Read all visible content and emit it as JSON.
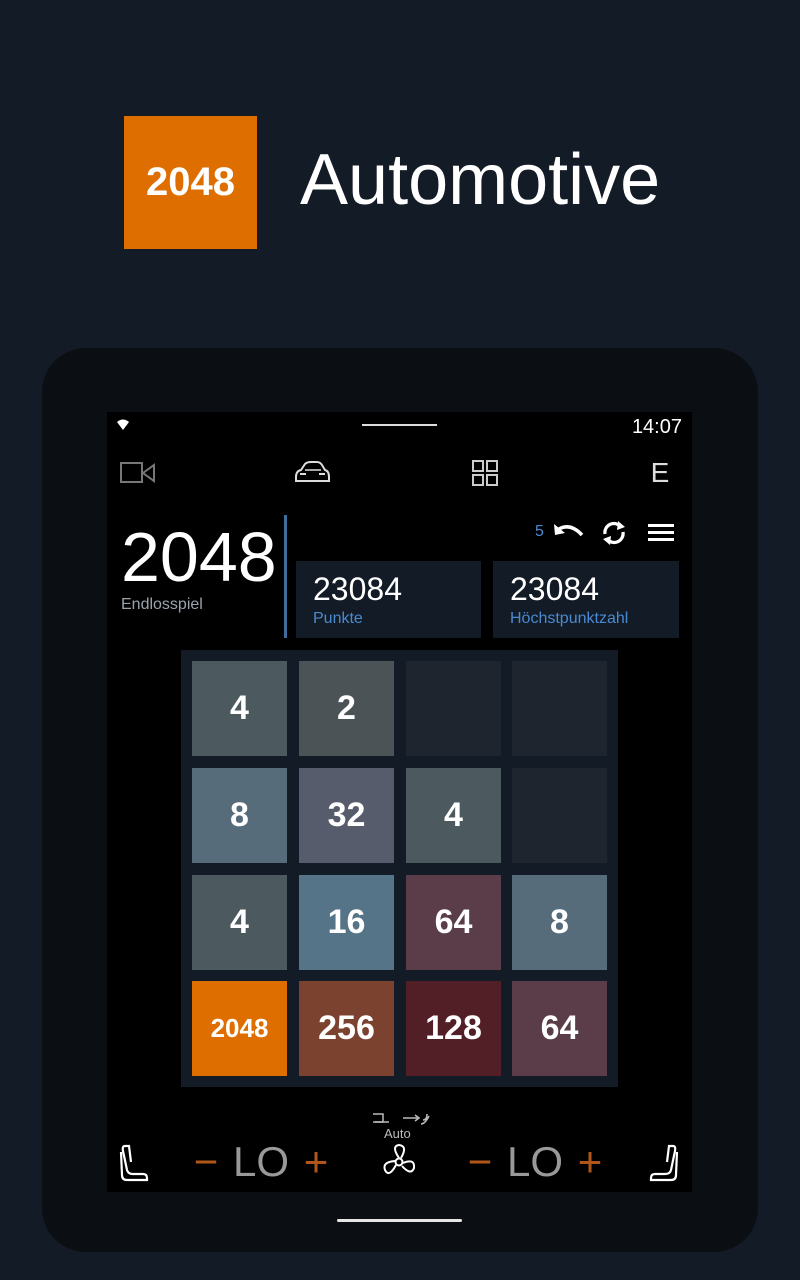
{
  "header": {
    "logo_text": "2048",
    "title": "Automotive"
  },
  "status_bar": {
    "time": "14:07"
  },
  "nav": {
    "cam_icon": "camera-icon",
    "car_icon": "car-icon",
    "apps_icon": "apps-grid-icon",
    "e_label": "E"
  },
  "game": {
    "title": "2048",
    "mode": "Endlosspiel",
    "undo_count": "5",
    "score": {
      "value": "23084",
      "label": "Punkte"
    },
    "best": {
      "value": "23084",
      "label": "Höchstpunktzahl"
    },
    "board": [
      [
        "4",
        "2",
        "",
        ""
      ],
      [
        "8",
        "32",
        "4",
        ""
      ],
      [
        "4",
        "16",
        "64",
        "8"
      ],
      [
        "2048",
        "256",
        "128",
        "64"
      ]
    ],
    "colors": {
      "empty": "#1e252f",
      "2": "#4b5357",
      "4": "#4c595f",
      "8": "#566c7b",
      "16": "#557487",
      "32": "#575c6d",
      "64": "#5a3d49",
      "128": "#531f27",
      "256": "#7c4230",
      "2048": "#de6e00"
    }
  },
  "climate": {
    "left": {
      "minus": "−",
      "value": "LO",
      "plus": "+"
    },
    "right": {
      "minus": "−",
      "value": "LO",
      "plus": "+"
    },
    "auto_label": "Auto"
  }
}
